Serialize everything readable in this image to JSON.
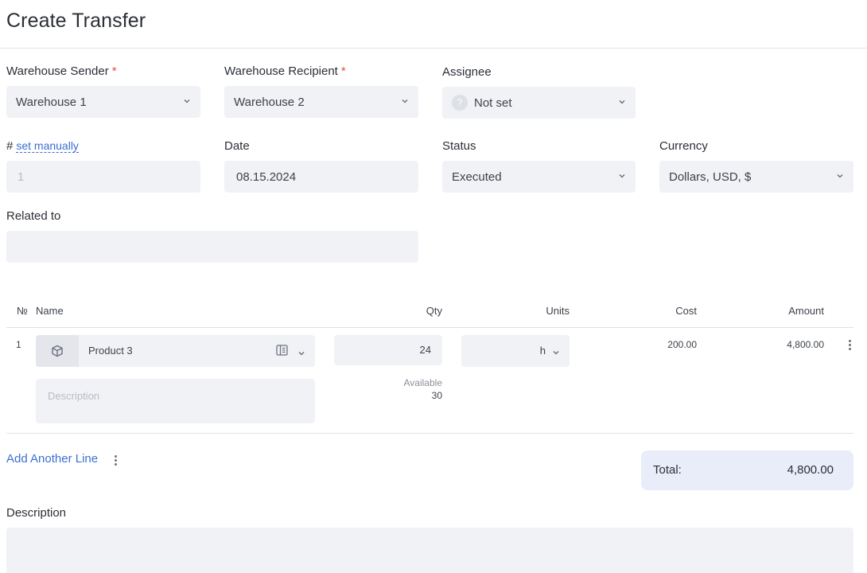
{
  "page": {
    "title": "Create Transfer"
  },
  "form": {
    "warehouse_sender": {
      "label": "Warehouse Sender",
      "required_mark": "*",
      "value": "Warehouse 1"
    },
    "warehouse_recipient": {
      "label": "Warehouse Recipient",
      "required_mark": "*",
      "value": "Warehouse 2"
    },
    "assignee": {
      "label": "Assignee",
      "value": "Not set",
      "avatar_glyph": "?"
    },
    "number": {
      "label": "#",
      "link": "set manually",
      "placeholder": "1"
    },
    "date": {
      "label": "Date",
      "value": "08.15.2024"
    },
    "status": {
      "label": "Status",
      "value": "Executed"
    },
    "currency": {
      "label": "Currency",
      "value": "Dollars, USD, $"
    },
    "related_to": {
      "label": "Related to",
      "value": ""
    }
  },
  "table": {
    "headers": {
      "no": "№",
      "name": "Name",
      "qty": "Qty",
      "units": "Units",
      "cost": "Cost",
      "amount": "Amount"
    },
    "rows": [
      {
        "no": "1",
        "product": "Product 3",
        "description_placeholder": "Description",
        "qty": "24",
        "available_label": "Available",
        "available_value": "30",
        "units": "h",
        "cost": "200.00",
        "amount": "4,800.00"
      }
    ]
  },
  "footer": {
    "add_line": "Add Another Line",
    "total_label": "Total:",
    "total_value": "4,800.00",
    "description_label": "Description"
  },
  "icons": {
    "chevron": "chevron-down-icon",
    "product": "cube-icon",
    "panel": "panel-icon",
    "menu": "kebab-icon"
  },
  "colors": {
    "link": "#3b6fd1",
    "required": "#e0504a",
    "field_bg": "#f1f2f6",
    "total_bg": "#e8edf9"
  }
}
